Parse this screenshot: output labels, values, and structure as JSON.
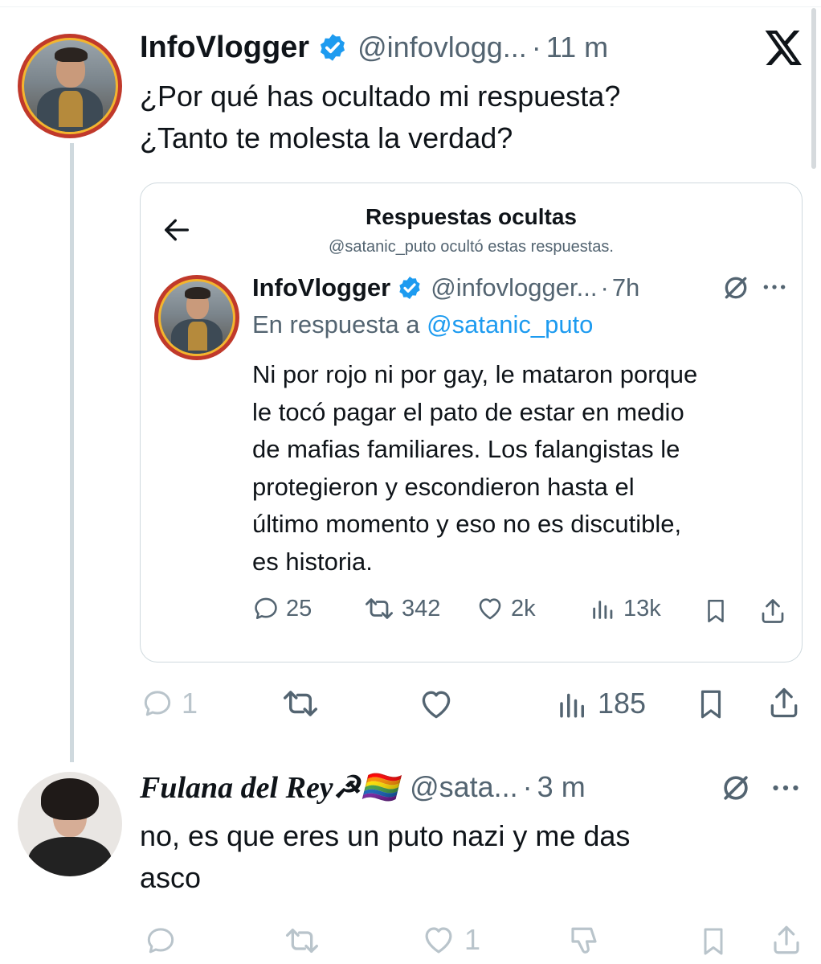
{
  "tweet": {
    "author_name": "InfoVlogger",
    "handle": "@infovlogg...",
    "separator": "·",
    "time": "11 m",
    "text_line1": "¿Por qué has ocultado mi respuesta?",
    "text_line2": "¿Tanto te molesta la verdad?",
    "actions": {
      "reply_count": "1",
      "views_count": "185"
    }
  },
  "quote": {
    "title": "Respuestas ocultas",
    "subtitle": "@satanic_puto ocultó estas respuestas.",
    "author_name": "InfoVlogger",
    "handle": "@infovlogger...",
    "separator": "·",
    "time": "7h",
    "reply_prefix": "En respuesta a ",
    "reply_to": "@satanic_puto",
    "body_lines": [
      "Ni por rojo ni por gay, le mataron porque",
      "le tocó pagar el pato de estar en medio",
      "de mafias familiares. Los falangistas le",
      "protegieron y escondieron hasta el",
      "último momento y eso no es discutible,",
      "es historia."
    ],
    "actions": {
      "replies": "25",
      "reposts": "342",
      "likes": "2k",
      "views": "13k"
    }
  },
  "reply": {
    "author_name": "Fulana del Rey☭🏳️‍🌈",
    "handle": "@sata...",
    "separator": "·",
    "time": "3 m",
    "text_line1": "no, es que eres un puto nazi y me das",
    "text_line2": "asco",
    "actions": {
      "likes": "1"
    }
  },
  "logo": "X",
  "colors": {
    "accent": "#1d9bf0",
    "secondary_text": "#536471",
    "verified": "#1d9bf0"
  }
}
